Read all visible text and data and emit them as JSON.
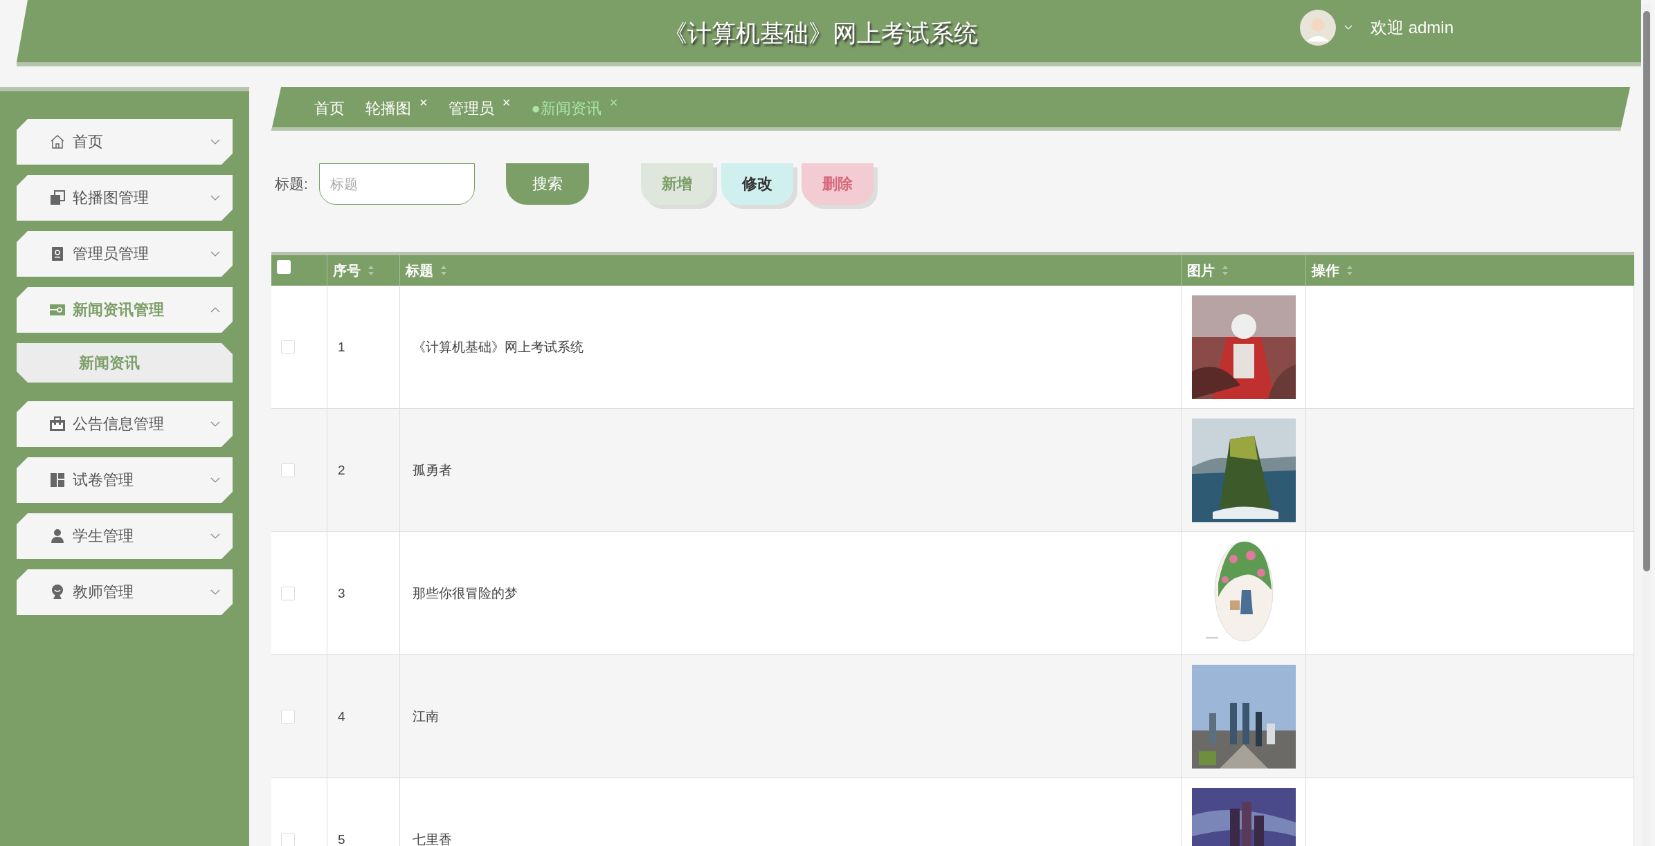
{
  "header": {
    "title": "《计算机基础》网上考试系统",
    "welcome": "欢迎 admin"
  },
  "sidebar": {
    "items": [
      {
        "label": "首页",
        "expanded": false
      },
      {
        "label": "轮播图管理",
        "expanded": false
      },
      {
        "label": "管理员管理",
        "expanded": false
      },
      {
        "label": "新闻资讯管理",
        "expanded": true,
        "children": [
          {
            "label": "新闻资讯",
            "selected": true
          }
        ]
      },
      {
        "label": "公告信息管理",
        "expanded": false
      },
      {
        "label": "试卷管理",
        "expanded": false
      },
      {
        "label": "学生管理",
        "expanded": false
      },
      {
        "label": "教师管理",
        "expanded": false
      }
    ]
  },
  "tabs": [
    {
      "label": "首页",
      "selected": false,
      "closable": false
    },
    {
      "label": "轮播图",
      "selected": false,
      "closable": true,
      "close": "×"
    },
    {
      "label": "管理员",
      "selected": false,
      "closable": true,
      "close": "×"
    },
    {
      "label": "新闻资讯",
      "selected": true,
      "closable": true,
      "close": "×",
      "marker": "●"
    }
  ],
  "search": {
    "label": "标题:",
    "placeholder": "标题",
    "button": "搜索"
  },
  "actions": [
    {
      "label": "新增",
      "kind": "add"
    },
    {
      "label": "修改",
      "kind": "edit"
    },
    {
      "label": "删除",
      "kind": "delete"
    }
  ],
  "table": {
    "select_all": {
      "checked": false
    },
    "columns": [
      {
        "label": "序号",
        "sortable": true
      },
      {
        "label": "标题",
        "sortable": true
      },
      {
        "label": "图片",
        "sortable": true
      },
      {
        "label": "操作",
        "sortable": true
      }
    ],
    "rows": [
      {
        "checked": false,
        "index": "1",
        "title": "《计算机基础》网上考试系统"
      },
      {
        "checked": false,
        "index": "2",
        "title": "孤勇者"
      },
      {
        "checked": false,
        "index": "3",
        "title": "那些你很冒险的梦"
      },
      {
        "checked": false,
        "index": "4",
        "title": "江南"
      },
      {
        "checked": false,
        "index": "5",
        "title": "七里香"
      }
    ]
  }
}
